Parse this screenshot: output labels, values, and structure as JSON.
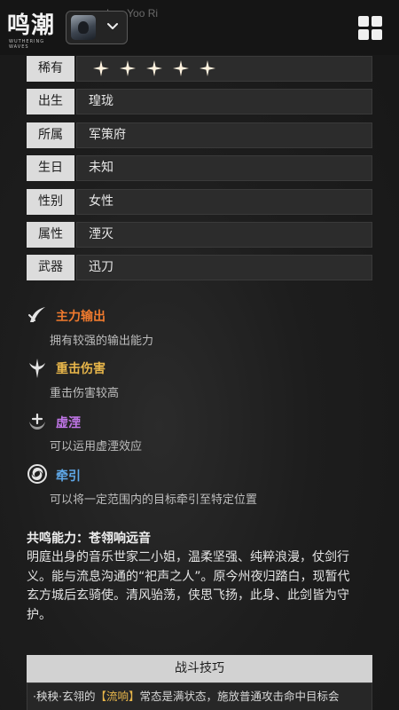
{
  "header": {
    "logo_text": "鸣潮",
    "logo_sub": "WUTHERING WAVES",
    "faded_name": "Lee Yoo Ri",
    "character_icon": "character-avatar",
    "dropdown_icon": "chevron-down-icon",
    "menu_icon": "grid-menu-icon"
  },
  "attributes": [
    {
      "key": "稀有",
      "value": "",
      "stars": 5
    },
    {
      "key": "出生",
      "value": "瑝珑"
    },
    {
      "key": "所属",
      "value": "军策府"
    },
    {
      "key": "生日",
      "value": "未知"
    },
    {
      "key": "性别",
      "value": "女性"
    },
    {
      "key": "属性",
      "value": "湮灭"
    },
    {
      "key": "武器",
      "value": "迅刀"
    }
  ],
  "tags": [
    {
      "title": "主力输出",
      "desc": "拥有较强的输出能力",
      "color": "#f07a2e",
      "icon": "crossed-swords-icon"
    },
    {
      "title": "重击伤害",
      "desc": "重击伤害较高",
      "color": "#e8b64a",
      "icon": "heavy-strike-icon"
    },
    {
      "title": "虚湮",
      "desc": "可以运用虚湮效应",
      "color": "#c176e8",
      "icon": "havoc-effect-icon"
    },
    {
      "title": "牵引",
      "desc": "可以将一定范围内的目标牵引至特定位置",
      "color": "#5fa8e8",
      "icon": "vortex-pull-icon"
    }
  ],
  "resonance": {
    "title": "共鸣能力：苍翎响远音",
    "body_lines": [
      "明庭出身的音乐世家二小姐，温柔坚强、纯粹浪漫，仗剑行",
      "义。能与流息沟通的“祀声之人”。原今州夜归踏白，现暂代",
      "玄方城后玄骑使。清风骀荡，侠思飞扬，此身、此剑皆为守",
      "护。"
    ]
  },
  "combat": {
    "header": "战斗技巧",
    "line_prefix": "·秧秧·玄翎的",
    "line_highlight": "【流响】",
    "line_suffix": "常态是满状态，施放普通攻击命中目标会"
  },
  "colors": {
    "highlight": "#e8b64a"
  }
}
